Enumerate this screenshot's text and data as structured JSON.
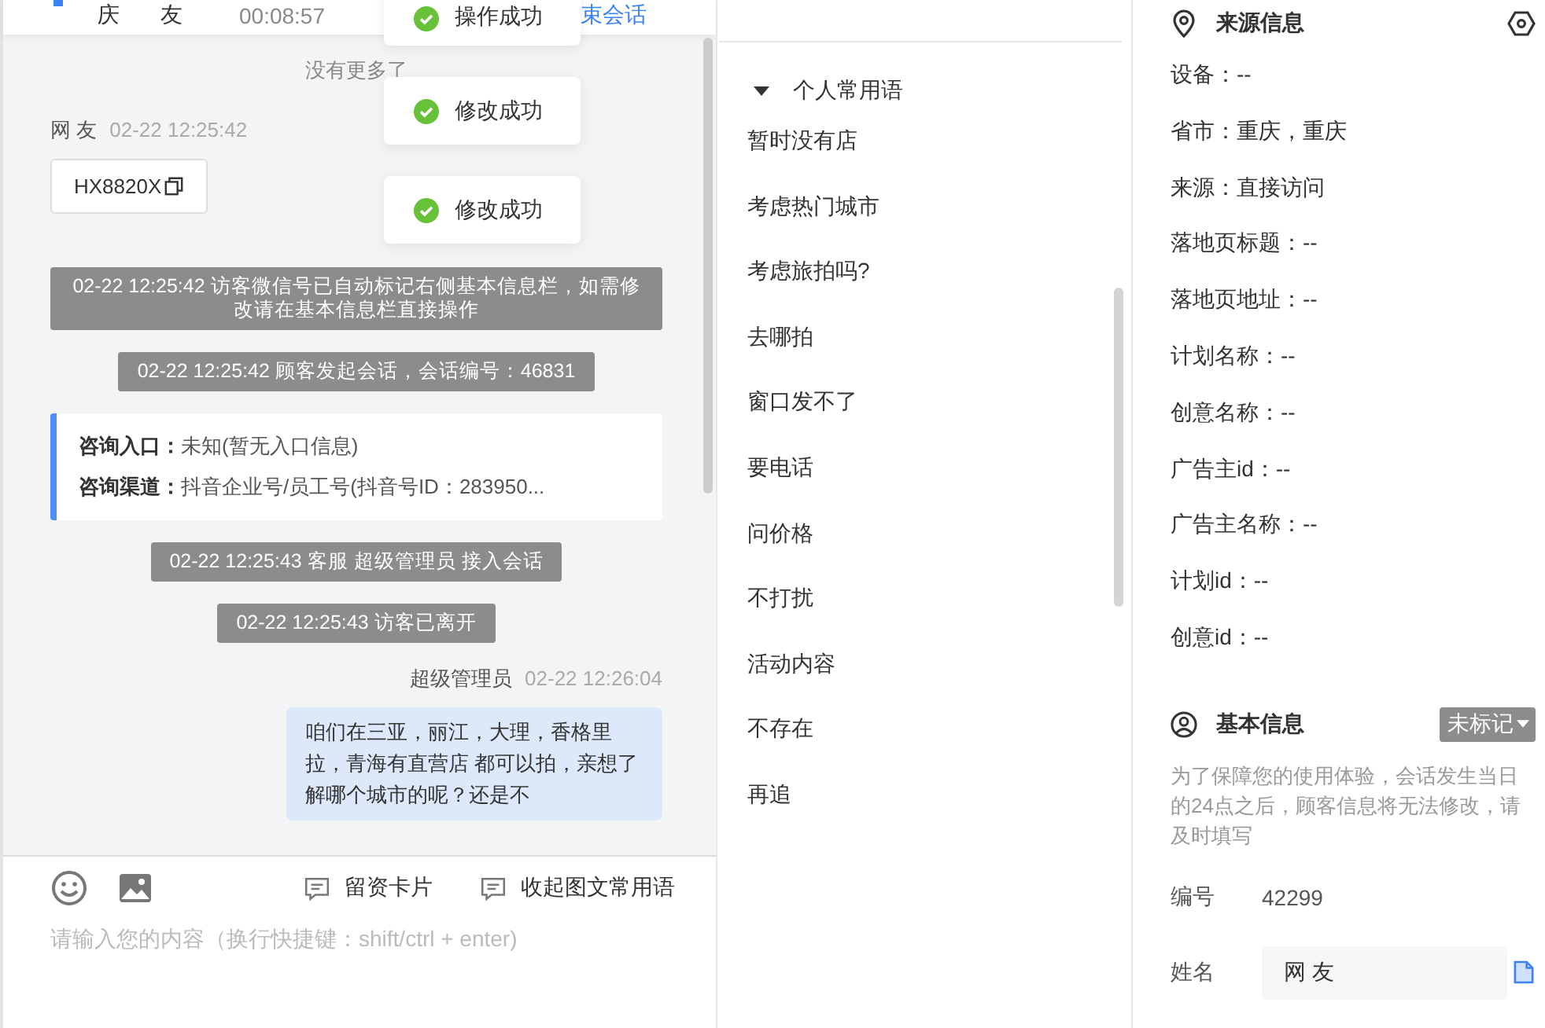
{
  "chat_header": {
    "name_parts": [
      "庆",
      "友"
    ],
    "duration": "00:08:57",
    "end_link": "束会话"
  },
  "toasts": [
    {
      "text": "操作成功",
      "kind": "success"
    },
    {
      "text": "修改成功",
      "kind": "success"
    },
    {
      "text": "修改成功",
      "kind": "success"
    }
  ],
  "messages": [
    {
      "kind": "notice",
      "text": "没有更多了"
    },
    {
      "kind": "visitor",
      "sender": "网 友",
      "time": "02-22 12:25:42",
      "text": "HX8820X"
    },
    {
      "kind": "system",
      "text": "02-22 12:25:42 访客微信号已自动标记右侧基本信息栏，如需修改请在基本信息栏直接操作"
    },
    {
      "kind": "system",
      "text": "02-22 12:25:42 顾客发起会话，会话编号：46831"
    },
    {
      "kind": "info",
      "rows": [
        {
          "label": "咨询入口：",
          "value": "未知(暂无入口信息)"
        },
        {
          "label": "咨询渠道：",
          "value": "抖音企业号/员工号(抖音号ID：283950..."
        }
      ]
    },
    {
      "kind": "system",
      "text": "02-22 12:25:43 客服 超级管理员 接入会话"
    },
    {
      "kind": "system",
      "text": "02-22 12:25:43 访客已离开"
    },
    {
      "kind": "agent",
      "sender": "超级管理员",
      "time": "02-22 12:26:04",
      "text": "咱们在三亚，丽江，大理，香格里拉，青海有直营店 都可以拍，亲想了解哪个城市的呢？还是不"
    }
  ],
  "composer": {
    "tools": [
      {
        "label": "留资卡片"
      },
      {
        "label": "收起图文常用语"
      }
    ],
    "placeholder": "请输入您的内容（换行快捷键：shift/ctrl + enter)"
  },
  "phrases": {
    "group": "个人常用语",
    "expanded": true,
    "items": [
      "暂时没有店",
      "考虑热门城市",
      "考虑旅拍吗?",
      "去哪拍",
      "窗口发不了",
      "要电话",
      "问价格",
      "不打扰",
      "活动内容",
      "不存在",
      "再追"
    ]
  },
  "source_info": {
    "title": "来源信息",
    "fields": [
      "设备：--",
      "省市：重庆，重庆",
      "来源：直接访问",
      "落地页标题：--",
      "落地页地址：--",
      "计划名称：--",
      "创意名称：--",
      "广告主id：--",
      "广告主名称：--",
      "计划id：--",
      "创意id：--"
    ]
  },
  "basic_info": {
    "title": "基本信息",
    "tag": "未标记",
    "note": "为了保障您的使用体验，会话发生当日的24点之后，顾客信息将无法修改，请及时填写",
    "fields": [
      {
        "kind": "text",
        "label": "编号",
        "value": "42299"
      },
      {
        "kind": "input",
        "label": "姓名",
        "value": "网 友"
      }
    ]
  }
}
